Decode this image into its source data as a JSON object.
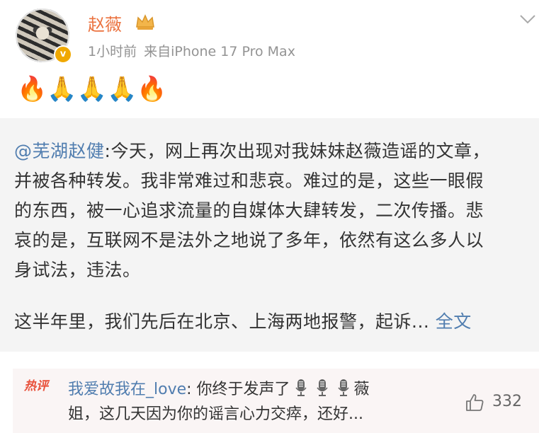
{
  "post": {
    "author": "赵薇",
    "time": "1小时前",
    "source": "来自iPhone 17 Pro Max",
    "text": "🔥🙏🙏🙏🔥"
  },
  "retweet": {
    "mention": "@芜湖赵健",
    "line1_rest": ":今天，网上再次出现对我妹妹赵薇造谣的文章，",
    "line2": "并被各种转发。我非常难过和悲哀。难过的是，这些一眼假",
    "line3": "的东西，被一心追求流量的自媒体大肆转发，二次传播。悲",
    "line4": "哀的是，互联网不是法外之地说了多年，依然有这么多人以",
    "line5": "身试法，违法。",
    "line6": "这半年里，我们先后在北京、上海两地报警，起诉...",
    "full_text_link": "全文"
  },
  "hot_comment": {
    "badge": "热评",
    "commenter": "我爱故我在_love",
    "line1_text": ": 你终于发声了",
    "line1_end": "薇",
    "line2": "姐，这几天因为你的谣言心力交瘁，还好...",
    "like_count": "332"
  },
  "colors": {
    "username": "#eb7340",
    "link": "#507daf",
    "hot_badge": "#e8503a",
    "retweet_bg": "#f4f4f4",
    "meta": "#939393"
  },
  "icons": [
    "avatar",
    "verified-badge-icon",
    "crown-icon",
    "chevron-down-icon",
    "microphone-icon",
    "like-icon"
  ]
}
